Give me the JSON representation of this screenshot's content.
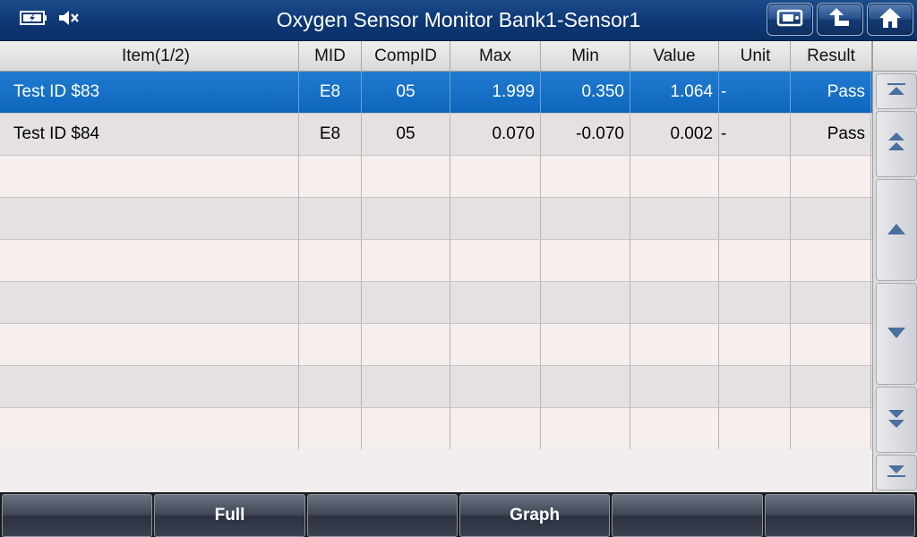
{
  "title": "Oxygen Sensor Monitor Bank1-Sensor1",
  "status_icons": [
    "battery-charging-icon",
    "speaker-muted-icon"
  ],
  "top_buttons": [
    "screenshot-icon",
    "back-icon",
    "home-icon"
  ],
  "table": {
    "headers": {
      "item": "Item(1/2)",
      "mid": "MID",
      "compid": "CompID",
      "max": "Max",
      "min": "Min",
      "value": "Value",
      "unit": "Unit",
      "result": "Result"
    },
    "rows": [
      {
        "item": "Test ID $83",
        "mid": "E8",
        "compid": "05",
        "max": "1.999",
        "min": "0.350",
        "value": "1.064",
        "unit": "-",
        "result": "Pass"
      },
      {
        "item": "Test ID $84",
        "mid": "E8",
        "compid": "05",
        "max": "0.070",
        "min": "-0.070",
        "value": "0.002",
        "unit": "-",
        "result": "Pass"
      }
    ],
    "selected_row": 0
  },
  "scroll_buttons": [
    "scroll-top-icon",
    "page-up-icon",
    "line-up-icon",
    "line-down-icon",
    "page-down-icon",
    "scroll-bottom-icon"
  ],
  "bottom_buttons": [
    "",
    "Full",
    "",
    "Graph",
    "",
    ""
  ],
  "colors": {
    "titlebar": "#0f3a78",
    "selected_row": "#1570c8",
    "row_odd": "#f6efee",
    "row_even": "#e5e1e3"
  }
}
